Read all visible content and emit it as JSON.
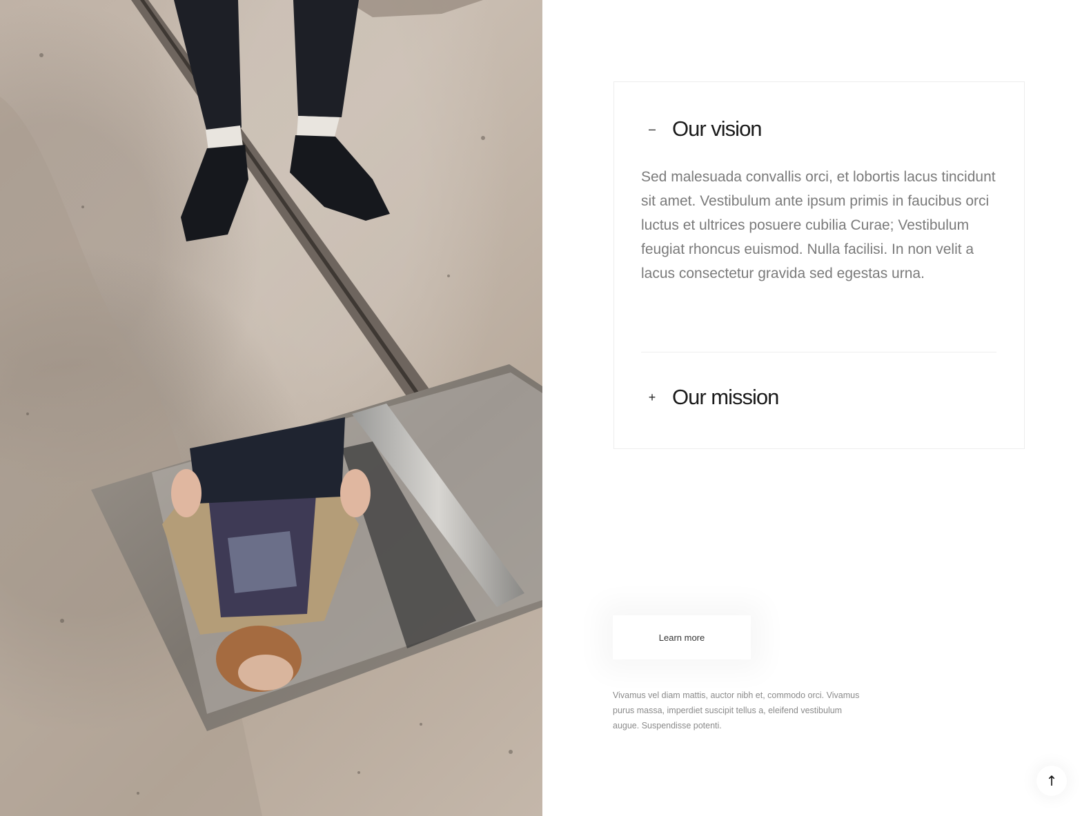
{
  "accordion": {
    "items": [
      {
        "toggle": "–",
        "title": "Our vision",
        "expanded": true,
        "body": "Sed malesuada convallis orci, et lobortis lacus tincidunt sit amet. Vestibulum ante ipsum primis in faucibus orci luctus et ultrices posuere cubilia Curae; Vestibulum feugiat rhoncus euismod. Nulla facilisi. In non velit a lacus consectetur gravida sed egestas urna."
      },
      {
        "toggle": "+",
        "title": "Our mission",
        "expanded": false
      }
    ]
  },
  "cta": {
    "learn_more_label": "Learn more"
  },
  "description": "Vivamus vel diam mattis, auctor nibh et, commodo orci. Vivamus purus massa, imperdiet suscipit tellus a, eleifend vestibulum augue. Suspendisse potenti.",
  "back_to_top": {
    "icon": "arrow-up-icon",
    "glyph": "↑"
  }
}
